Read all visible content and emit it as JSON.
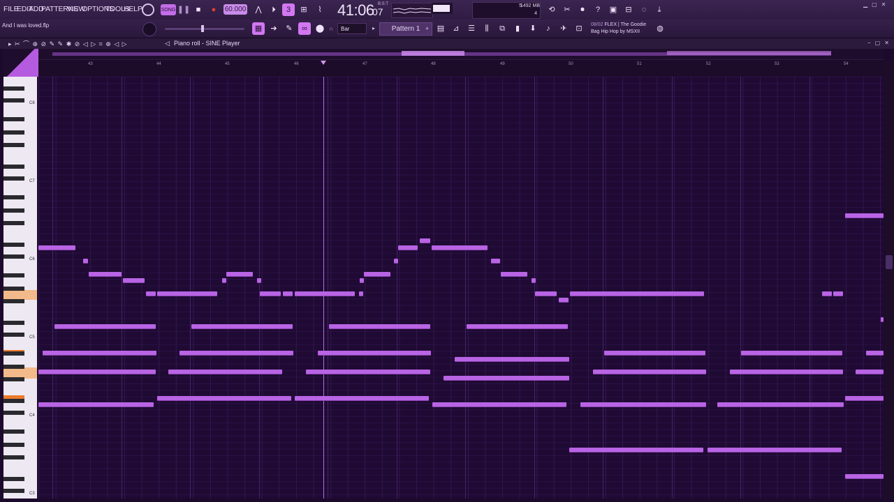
{
  "menu": [
    "FILE",
    "EDIT",
    "ADD",
    "PATTERNS",
    "VIEW",
    "OPTIONS",
    "TOOLS",
    "HELP"
  ],
  "transport": {
    "mode": "SONG",
    "tempo": "60.000",
    "time": "41:06",
    "time_frac": "07",
    "time_unit": "B:S:T"
  },
  "meters": {
    "cpu": "5",
    "memory": "1492 MB",
    "voices": "4"
  },
  "hint_text": "And I was loved.flp",
  "snap": "Bar",
  "pattern": "Pattern 1",
  "news": {
    "index": "08/02",
    "line1": "FLEX | The Goodie",
    "line2": "Bag Hip Hop by MSXII"
  },
  "piano_roll": {
    "title": "Piano roll - SINE Player",
    "bar_numbers": [
      "43",
      "44",
      "45",
      "46",
      "47",
      "48",
      "49",
      "50",
      "51",
      "52",
      "53",
      "54"
    ],
    "octave_labels": [
      "C8",
      "C7",
      "C6",
      "C5",
      "C4",
      "C3"
    ]
  },
  "colors": {
    "note": "#b864e4",
    "accent": "#d177f0",
    "background": "#1f0a34",
    "key_highlight": "#ec7a2c"
  },
  "icons": {
    "window_controls": [
      "minimize-icon",
      "restore-icon",
      "close-icon"
    ]
  }
}
